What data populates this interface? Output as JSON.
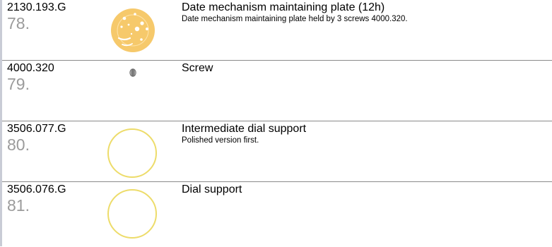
{
  "rows": [
    {
      "ref": "2130.193.G",
      "index": "78.",
      "title": "Date mechanism maintaining plate (12h)",
      "description": "Date mechanism maintaining plate held by 3 screws 4000.320.",
      "icon": "date-plate-icon"
    },
    {
      "ref": "4000.320",
      "index": "79.",
      "title": "Screw",
      "description": "",
      "icon": "screw-icon"
    },
    {
      "ref": "3506.077.G",
      "index": "80.",
      "title": "Intermediate dial support",
      "description": "Polished version first.",
      "icon": "ring-icon"
    },
    {
      "ref": "3506.076.G",
      "index": "81.",
      "title": "Dial support",
      "description": "",
      "icon": "ring-icon"
    }
  ],
  "colors": {
    "gold_fill": "#f6c96b",
    "gold_stroke": "#eddc6a",
    "index_gray": "#9b9b9b",
    "divider": "#8a8a8a"
  }
}
